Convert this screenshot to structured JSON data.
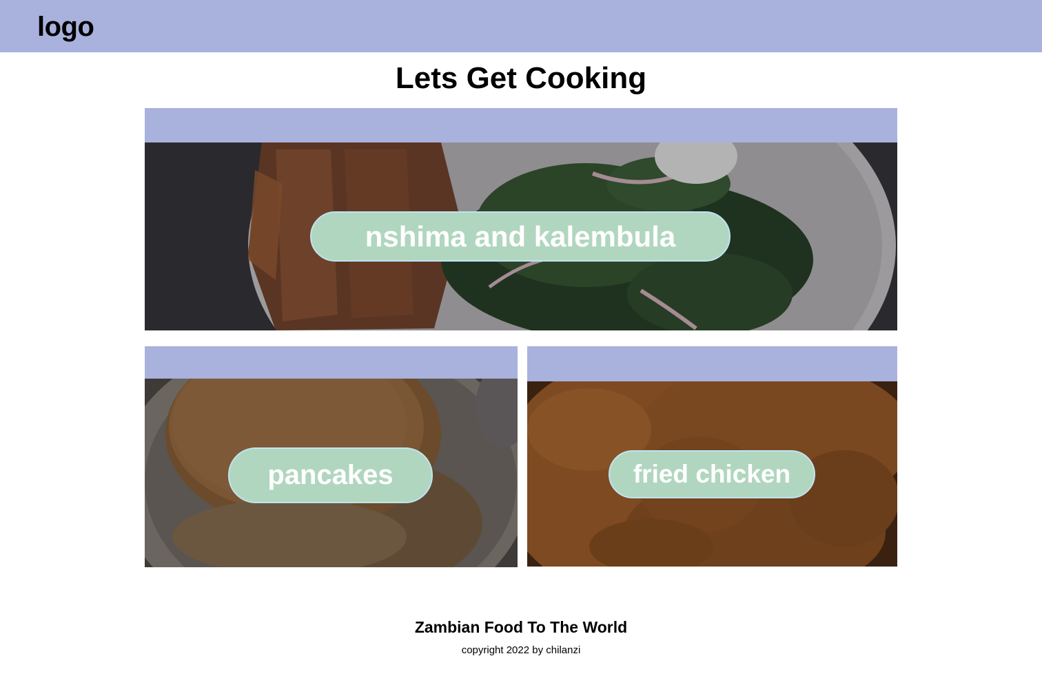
{
  "header": {
    "logo_text": "logo",
    "background": "#a9b1dd"
  },
  "main": {
    "title": "Lets Get Cooking",
    "cards": [
      {
        "label": "nshima and kalembula",
        "image": "plate of nshima with kalembula greens"
      },
      {
        "label": "pancakes",
        "image": "stack of pancakes"
      },
      {
        "label": "fried chicken",
        "image": "fried chicken close-up"
      }
    ]
  },
  "footer": {
    "title": "Zambian Food To The World",
    "copyright": "copyright 2022 by chilanzi"
  },
  "colors": {
    "band": "#a9b1dd",
    "pill": "#b1d6bf",
    "pill_border": "#bfe3f3",
    "pill_text": "#ffffff"
  }
}
